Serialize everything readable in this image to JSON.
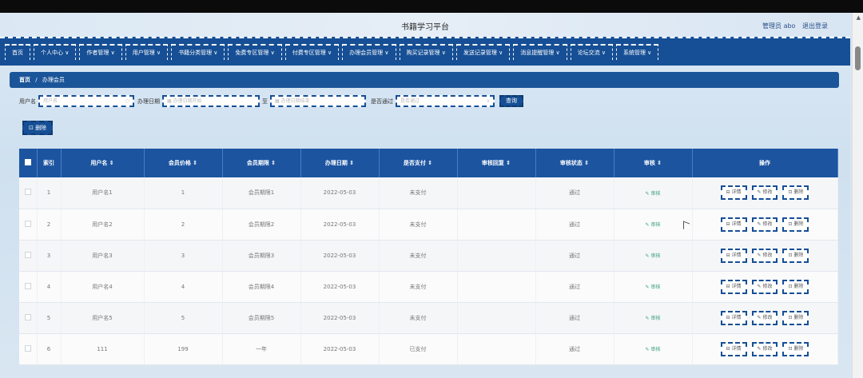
{
  "header": {
    "title": "书籍学习平台",
    "user_label": "管理员 abo",
    "logout": "退出登录"
  },
  "nav": [
    "首页",
    "个人中心 ∨",
    "作者管理 ∨",
    "用户管理 ∨",
    "书籍分类管理 ∨",
    "免费专区管理 ∨",
    "付费专区管理 ∨",
    "办理会员管理 ∨",
    "购买记录管理 ∨",
    "发送记录管理 ∨",
    "消息提醒管理 ∨",
    "论坛交流 ∨",
    "系统管理 ∨"
  ],
  "breadcrumb": {
    "home": "首页",
    "sep": "/",
    "current": "办理会员"
  },
  "search": {
    "username_label": "用户名",
    "username_placeholder": "用户名",
    "date_label": "办理日期",
    "date_start_placeholder": "办理日期开始",
    "to_label": "至",
    "date_end_placeholder": "办理日期结束",
    "paid_label": "是否通过",
    "paid_placeholder": "是否通过",
    "query_button": "查询"
  },
  "delete_button": "删除",
  "table": {
    "headers": [
      "索引",
      "用户名 ⇕",
      "会员价格 ⇕",
      "会员期限 ⇕",
      "办理日期 ⇕",
      "是否支付 ⇕",
      "审核回复 ⇕",
      "审核状态 ⇕",
      "审核 ⇕",
      "操作"
    ],
    "rows": [
      {
        "idx": "1",
        "username": "用户名1",
        "price": "1",
        "term": "会员期限1",
        "date": "2022-05-03",
        "paid": "未支付",
        "reply": "",
        "status": "通过",
        "audit": "审核"
      },
      {
        "idx": "2",
        "username": "用户名2",
        "price": "2",
        "term": "会员期限2",
        "date": "2022-05-03",
        "paid": "未支付",
        "reply": "",
        "status": "通过",
        "audit": "审核"
      },
      {
        "idx": "3",
        "username": "用户名3",
        "price": "3",
        "term": "会员期限3",
        "date": "2022-05-03",
        "paid": "未支付",
        "reply": "",
        "status": "通过",
        "audit": "审核"
      },
      {
        "idx": "4",
        "username": "用户名4",
        "price": "4",
        "term": "会员期限4",
        "date": "2022-05-03",
        "paid": "未支付",
        "reply": "",
        "status": "通过",
        "audit": "审核"
      },
      {
        "idx": "5",
        "username": "用户名5",
        "price": "5",
        "term": "会员期限5",
        "date": "2022-05-03",
        "paid": "未支付",
        "reply": "",
        "status": "通过",
        "audit": "审核"
      },
      {
        "idx": "6",
        "username": "111",
        "price": "199",
        "term": "一年",
        "date": "2022-05-03",
        "paid": "已支付",
        "reply": "",
        "status": "通过",
        "audit": "审核"
      }
    ],
    "actions": {
      "detail": "详情",
      "edit": "修改",
      "delete": "删除"
    }
  },
  "colors": {
    "primary": "#164f95",
    "header_bg": "#1c54a0",
    "audit_link": "#3aa07a"
  }
}
